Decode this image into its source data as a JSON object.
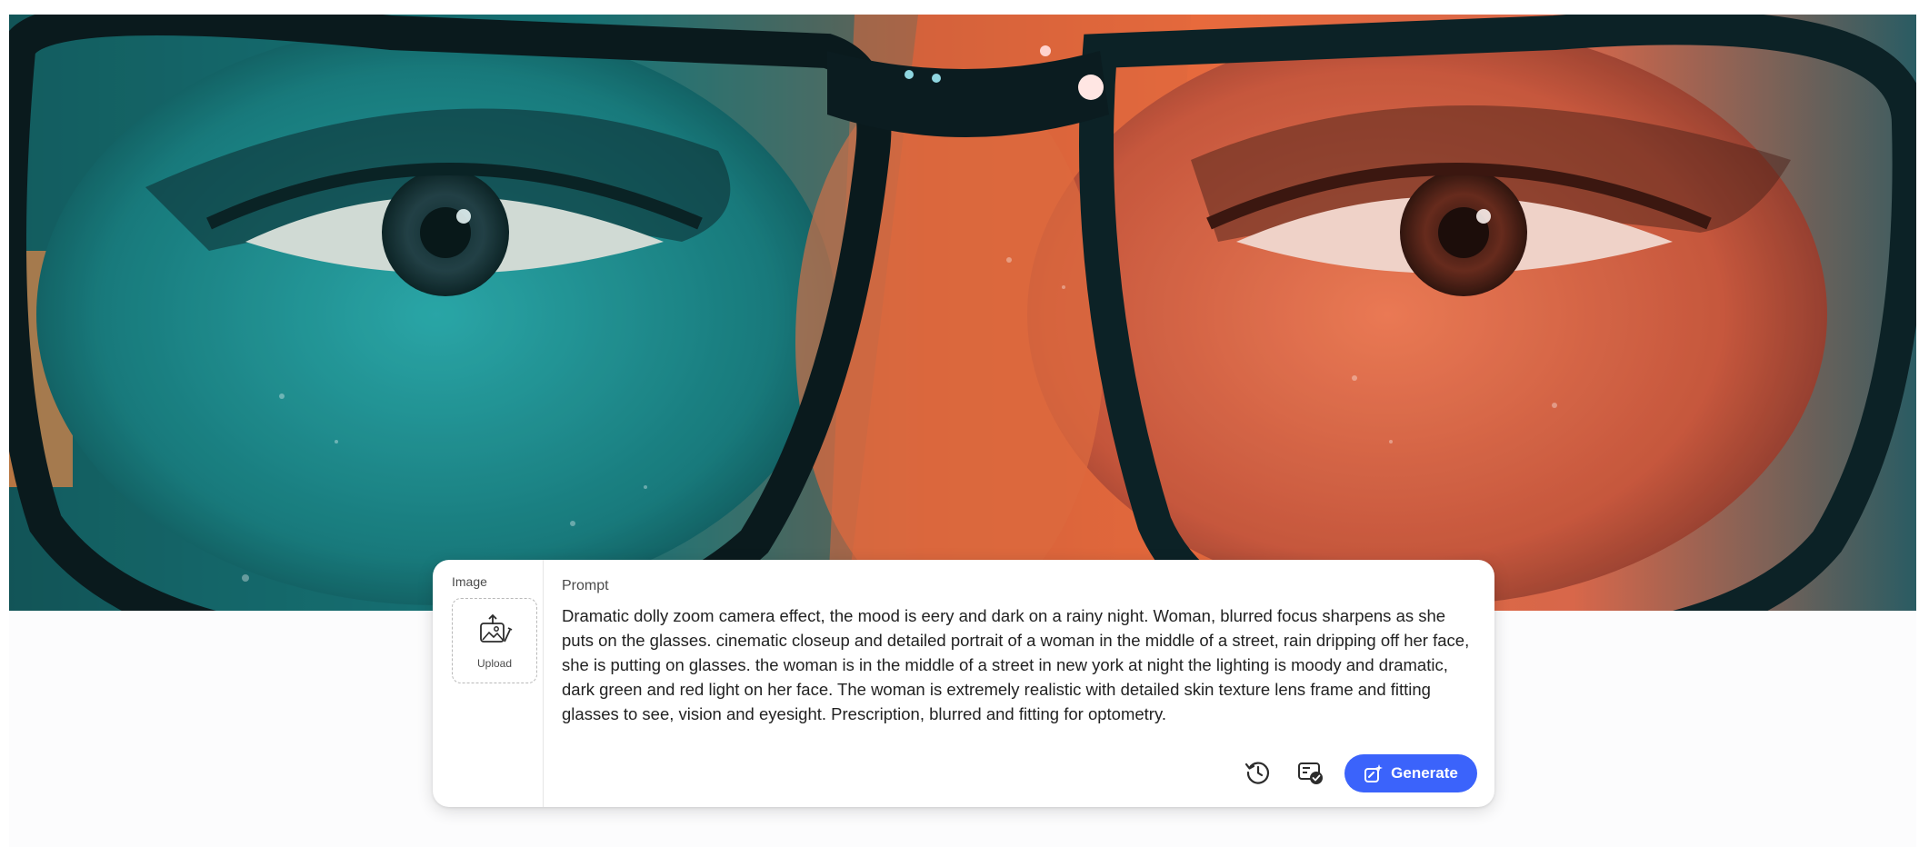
{
  "hero": {
    "icon": "closeup-woman-glasses-image"
  },
  "prompt_panel": {
    "image_label": "Image",
    "upload_label": "Upload",
    "prompt_label": "Prompt",
    "prompt_text": "Dramatic dolly zoom camera effect, the mood is eery and dark on a rainy night. Woman, blurred focus sharpens as she puts on the glasses. cinematic closeup and detailed portrait of a woman in the middle of a street, rain dripping off her face, she is putting on glasses. the woman is in the middle of a street in new york at night the lighting is moody and dramatic, dark green and red light on her face. The woman is extremely realistic with detailed skin texture lens frame and fitting glasses to see, vision and eyesight. Prescription, blurred and fitting for optometry.",
    "generate_label": "Generate"
  },
  "colors": {
    "accent": "#3b63fb",
    "card_bg": "#ffffff",
    "text": "#222222",
    "muted": "#4b4b4b"
  },
  "icons": {
    "upload": "image-upload-icon",
    "history": "history-icon",
    "credits": "credits-badge-icon",
    "generate": "generate-sparkle-icon"
  }
}
